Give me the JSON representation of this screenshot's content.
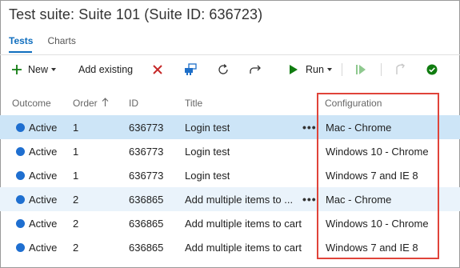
{
  "title": "Test suite: Suite 101 (Suite ID: 636723)",
  "tabs": [
    {
      "label": "Tests",
      "active": true
    },
    {
      "label": "Charts",
      "active": false
    }
  ],
  "toolbar": {
    "new_label": "New",
    "add_existing_label": "Add existing",
    "run_label": "Run"
  },
  "columns": {
    "outcome": "Outcome",
    "order": "Order",
    "id": "ID",
    "title": "Title",
    "configuration": "Configuration"
  },
  "rows": [
    {
      "outcome": "Active",
      "order": "1",
      "id": "636773",
      "title": "Login test",
      "configuration": "Mac - Chrome"
    },
    {
      "outcome": "Active",
      "order": "1",
      "id": "636773",
      "title": "Login test",
      "configuration": "Windows 10 - Chrome"
    },
    {
      "outcome": "Active",
      "order": "1",
      "id": "636773",
      "title": "Login test",
      "configuration": "Windows 7 and IE 8"
    },
    {
      "outcome": "Active",
      "order": "2",
      "id": "636865",
      "title": "Add multiple items to ...",
      "configuration": "Mac - Chrome"
    },
    {
      "outcome": "Active",
      "order": "2",
      "id": "636865",
      "title": "Add multiple items to cart",
      "configuration": "Windows 10 - Chrome"
    },
    {
      "outcome": "Active",
      "order": "2",
      "id": "636865",
      "title": "Add multiple items to cart",
      "configuration": "Windows 7 and IE 8"
    }
  ],
  "colors": {
    "accent": "#106ebe",
    "selected_row": "#cde5f7",
    "hover_row": "#eaf3fb",
    "active_dot": "#1f6fd0",
    "highlight_border": "#e0443a",
    "delete_red": "#c62828",
    "run_green": "#107c10"
  }
}
